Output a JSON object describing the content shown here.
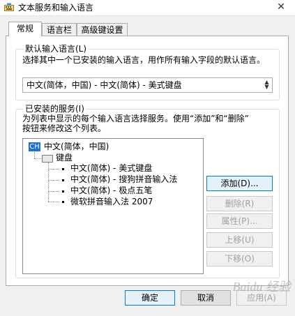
{
  "window": {
    "title": "文本服务和输入语言",
    "close_symbol": "✕"
  },
  "tabs": [
    {
      "label": "常规",
      "active": true
    },
    {
      "label": "语言栏",
      "active": false
    },
    {
      "label": "高级键设置",
      "active": false
    }
  ],
  "default_language": {
    "legend": "默认输入语言(L)",
    "description": "选择其中一个已安装的输入语言，用作所有输入字段的默认语言。",
    "selected": "中文(简体，中国) - 中文(简体) - 美式键盘"
  },
  "installed_services": {
    "legend": "已安装的服务(I)",
    "description_line1": "为列表中显示的每个输入语言选择服务。使用“添加”和“删除”",
    "description_line2": "按钮来修改这个列表。",
    "tree": {
      "language_badge": "CH",
      "language": "中文(简体，中国)",
      "category": "键盘",
      "items": [
        "中文(简体) - 美式键盘",
        "中文(简体) - 搜狗拼音输入法",
        "中文(简体) - 极点五笔",
        "微软拼音输入法 2007"
      ]
    },
    "buttons": {
      "add": "添加(D)...",
      "remove": "删除(R)",
      "properties": "属性(P)...",
      "move_up": "上移(U)",
      "move_down": "下移(O)"
    }
  },
  "footer": {
    "ok": "确定",
    "cancel": "取消",
    "apply": "应用(A)"
  },
  "watermark": "Baidu 经验"
}
